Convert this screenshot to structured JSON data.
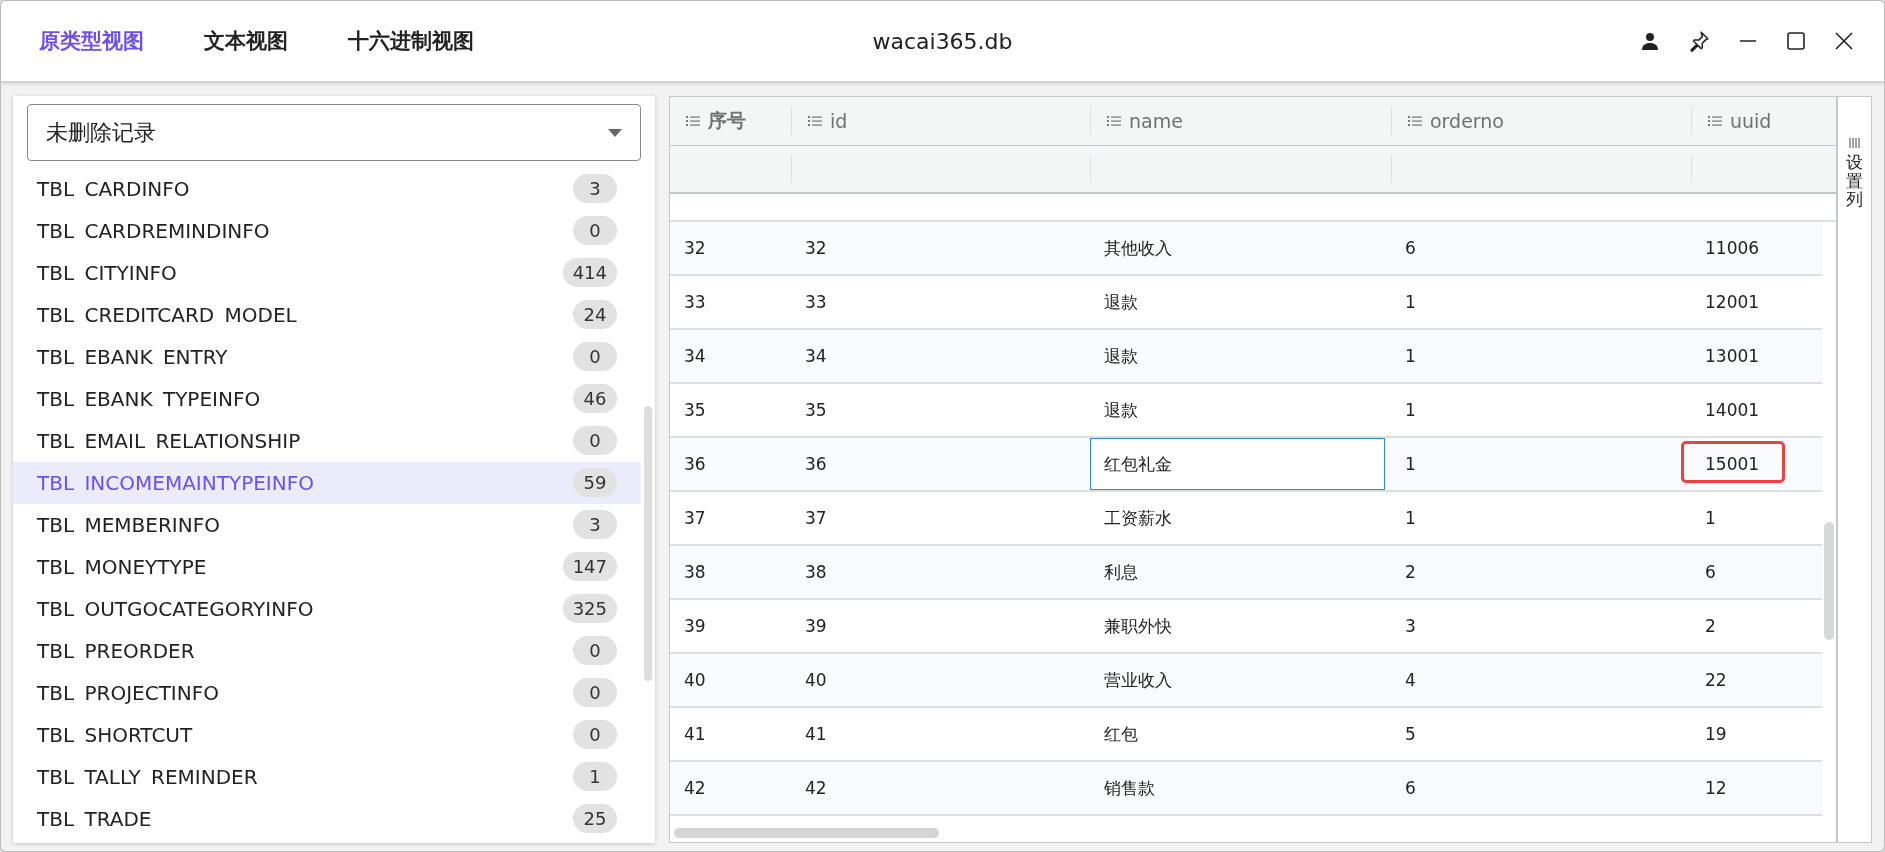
{
  "window": {
    "title": "wacai365.db"
  },
  "tabs": [
    {
      "label": "原类型视图",
      "selected": true
    },
    {
      "label": "文本视图",
      "selected": false
    },
    {
      "label": "十六进制视图",
      "selected": false
    }
  ],
  "filter": {
    "value": "未删除记录"
  },
  "tables": [
    {
      "name": "TBL CARDINFO",
      "count": "3",
      "selected": false
    },
    {
      "name": "TBL CARDREMINDINFO",
      "count": "0",
      "selected": false
    },
    {
      "name": "TBL CITYINFO",
      "count": "414",
      "selected": false
    },
    {
      "name": "TBL CREDITCARD MODEL",
      "count": "24",
      "selected": false
    },
    {
      "name": "TBL EBANK ENTRY",
      "count": "0",
      "selected": false
    },
    {
      "name": "TBL EBANK TYPEINFO",
      "count": "46",
      "selected": false
    },
    {
      "name": "TBL EMAIL RELATIONSHIP",
      "count": "0",
      "selected": false
    },
    {
      "name": "TBL INCOMEMAINTYPEINFO",
      "count": "59",
      "selected": true
    },
    {
      "name": "TBL MEMBERINFO",
      "count": "3",
      "selected": false
    },
    {
      "name": "TBL MONEYTYPE",
      "count": "147",
      "selected": false
    },
    {
      "name": "TBL OUTGOCATEGORYINFO",
      "count": "325",
      "selected": false
    },
    {
      "name": "TBL PREORDER",
      "count": "0",
      "selected": false
    },
    {
      "name": "TBL PROJECTINFO",
      "count": "0",
      "selected": false
    },
    {
      "name": "TBL SHORTCUT",
      "count": "0",
      "selected": false
    },
    {
      "name": "TBL TALLY REMINDER",
      "count": "1",
      "selected": false
    },
    {
      "name": "TBL TRADE",
      "count": "25",
      "selected": false
    }
  ],
  "table": {
    "columns": [
      {
        "label": "序号"
      },
      {
        "label": "id"
      },
      {
        "label": "name"
      },
      {
        "label": "orderno"
      },
      {
        "label": "uuid"
      }
    ],
    "settings_label": "设置列",
    "rows": [
      {
        "cells": [
          {
            "text": "32"
          },
          {
            "text": "32"
          },
          {
            "text": "其他收入"
          },
          {
            "text": "6"
          },
          {
            "text": "11006"
          }
        ]
      },
      {
        "cells": [
          {
            "text": "33"
          },
          {
            "text": "33"
          },
          {
            "text": "退款"
          },
          {
            "text": "1"
          },
          {
            "text": "12001"
          }
        ]
      },
      {
        "cells": [
          {
            "text": "34"
          },
          {
            "text": "34"
          },
          {
            "text": "退款"
          },
          {
            "text": "1"
          },
          {
            "text": "13001"
          }
        ]
      },
      {
        "cells": [
          {
            "text": "35"
          },
          {
            "text": "35"
          },
          {
            "text": "退款"
          },
          {
            "text": "1"
          },
          {
            "text": "14001"
          }
        ]
      },
      {
        "cells": [
          {
            "text": "36"
          },
          {
            "text": "36"
          },
          {
            "text": "红包礼金",
            "focused": true
          },
          {
            "text": "1"
          },
          {
            "text": "15001",
            "marked": true
          }
        ]
      },
      {
        "cells": [
          {
            "text": "37"
          },
          {
            "text": "37"
          },
          {
            "text": "工资薪水"
          },
          {
            "text": "1"
          },
          {
            "text": "1"
          }
        ]
      },
      {
        "cells": [
          {
            "text": "38"
          },
          {
            "text": "38"
          },
          {
            "text": "利息"
          },
          {
            "text": "2"
          },
          {
            "text": "6"
          }
        ]
      },
      {
        "cells": [
          {
            "text": "39"
          },
          {
            "text": "39"
          },
          {
            "text": "兼职外快"
          },
          {
            "text": "3"
          },
          {
            "text": "2"
          }
        ]
      },
      {
        "cells": [
          {
            "text": "40"
          },
          {
            "text": "40"
          },
          {
            "text": "营业收入"
          },
          {
            "text": "4"
          },
          {
            "text": "22"
          }
        ]
      },
      {
        "cells": [
          {
            "text": "41"
          },
          {
            "text": "41"
          },
          {
            "text": "红包"
          },
          {
            "text": "5"
          },
          {
            "text": "19"
          }
        ]
      },
      {
        "cells": [
          {
            "text": "42"
          },
          {
            "text": "42"
          },
          {
            "text": "销售款"
          },
          {
            "text": "6"
          },
          {
            "text": "12"
          }
        ]
      }
    ]
  }
}
